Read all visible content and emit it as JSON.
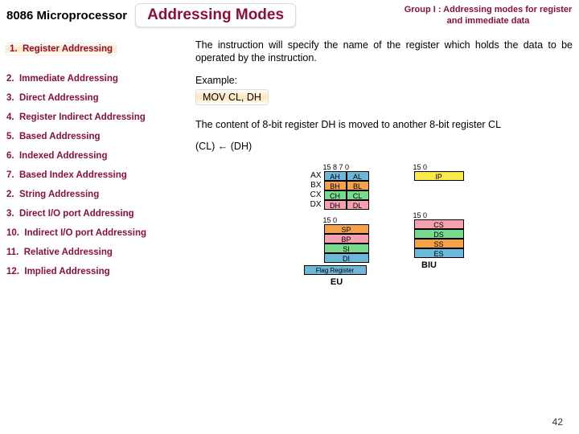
{
  "header": {
    "processor": "8086 Microprocessor",
    "title": "Addressing Modes",
    "group": "Group I : Addressing modes for register and immediate data"
  },
  "modes": [
    {
      "n": "1.",
      "t": "Register Addressing",
      "hl": true
    },
    {
      "n": "2.",
      "t": "Immediate Addressing",
      "hl": false
    },
    {
      "n": "3.",
      "t": "Direct Addressing",
      "hl": false
    },
    {
      "n": "4.",
      "t": "Register Indirect Addressing",
      "hl": false
    },
    {
      "n": "5.",
      "t": "Based Addressing",
      "hl": false
    },
    {
      "n": "6.",
      "t": "Indexed Addressing",
      "hl": false
    },
    {
      "n": "7.",
      "t": "Based Index Addressing",
      "hl": false
    },
    {
      "n": "2.",
      "t": "String Addressing",
      "hl": false
    },
    {
      "n": "3.",
      "t": "Direct I/O port Addressing",
      "hl": false
    },
    {
      "n": "10.",
      "t": "Indirect I/O port Addressing",
      "hl": false
    },
    {
      "n": "11.",
      "t": "Relative Addressing",
      "hl": false
    },
    {
      "n": "12.",
      "t": "Implied Addressing",
      "hl": false
    }
  ],
  "body": {
    "desc": "The instruction will specify the name of the register which holds the data to be operated by the instruction.",
    "example_label": "Example:",
    "example_code": "MOV CL, DH",
    "explain": "The content of 8-bit register DH is moved to another 8-bit register CL",
    "equation": "(CL) ← (DH)"
  },
  "diagram": {
    "gp": {
      "bits_top": "15        8 7        0",
      "rows": [
        {
          "lbl": "AX",
          "h": "AH",
          "l": "AL",
          "c": "blue"
        },
        {
          "lbl": "BX",
          "h": "BH",
          "l": "BL",
          "c": "orange"
        },
        {
          "lbl": "CX",
          "h": "CH",
          "l": "CL",
          "c": "green"
        },
        {
          "lbl": "DX",
          "h": "DH",
          "l": "DL",
          "c": "pink"
        }
      ]
    },
    "ip": {
      "bits_top": "15                    0",
      "lbl": "IP",
      "c": "yellow"
    },
    "ptr": {
      "bits_top": "15                0",
      "rows": [
        {
          "lbl": "SP",
          "c": "orange"
        },
        {
          "lbl": "BP",
          "c": "pink"
        },
        {
          "lbl": "SI",
          "c": "green"
        },
        {
          "lbl": "DI",
          "c": "blue"
        }
      ],
      "flag": {
        "lbl": "Flag Register",
        "c": "blue"
      }
    },
    "seg": {
      "bits_top": "15                0",
      "rows": [
        {
          "lbl": "CS",
          "c": "pink"
        },
        {
          "lbl": "DS",
          "c": "green"
        },
        {
          "lbl": "SS",
          "c": "orange"
        },
        {
          "lbl": "ES",
          "c": "blue"
        }
      ]
    },
    "unit_left": "EU",
    "unit_right": "BIU"
  },
  "page": "42"
}
